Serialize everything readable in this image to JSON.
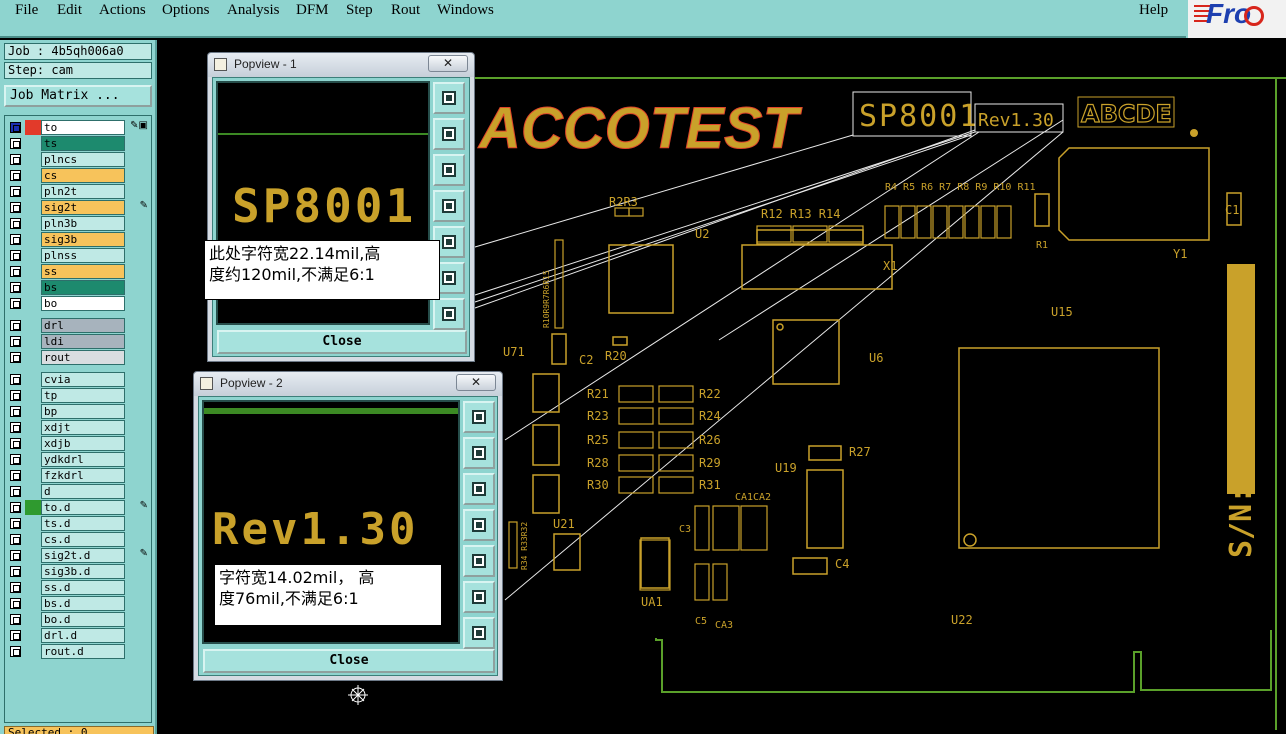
{
  "menu": {
    "items": [
      "File",
      "Edit",
      "Actions",
      "Options",
      "Analysis",
      "DFM",
      "Step",
      "Rout",
      "Windows"
    ],
    "help": "Help"
  },
  "logo": {
    "text": "Fro"
  },
  "job": {
    "label": "Job : 4b5qh006a0",
    "step": "Step: cam",
    "matrix_button": "Job Matrix ..."
  },
  "layers": [
    {
      "name": "to",
      "color": "#ffffff",
      "marker": "#e23a2a",
      "flag": "✎▣"
    },
    {
      "name": "ts",
      "color": "#1d8a6e",
      "marker": "",
      "flag": ""
    },
    {
      "name": "plncs",
      "color": "#bfe9e5",
      "marker": "",
      "flag": ""
    },
    {
      "name": "cs",
      "color": "#f7c35b",
      "marker": "",
      "flag": ""
    },
    {
      "name": "pln2t",
      "color": "#bfe9e5",
      "marker": "",
      "flag": ""
    },
    {
      "name": "sig2t",
      "color": "#f7c35b",
      "marker": "",
      "flag": "✎"
    },
    {
      "name": "pln3b",
      "color": "#bfe9e5",
      "marker": "",
      "flag": ""
    },
    {
      "name": "sig3b",
      "color": "#f7c35b",
      "marker": "",
      "flag": ""
    },
    {
      "name": "plnss",
      "color": "#bfe9e5",
      "marker": "",
      "flag": ""
    },
    {
      "name": "ss",
      "color": "#f7c35b",
      "marker": "",
      "flag": ""
    },
    {
      "name": "bs",
      "color": "#1d8a6e",
      "marker": "",
      "flag": ""
    },
    {
      "name": "bo",
      "color": "#ffffff",
      "marker": "",
      "flag": ""
    },
    {
      "name": "drl",
      "color": "#a7b3bd",
      "marker": "",
      "flag": ""
    },
    {
      "name": "ldi",
      "color": "#a7b3bd",
      "marker": "",
      "flag": ""
    },
    {
      "name": "rout",
      "color": "#d9dde0",
      "marker": "",
      "flag": ""
    },
    {
      "name": "cvia",
      "color": "#bfe9e5",
      "marker": "",
      "flag": ""
    },
    {
      "name": "tp",
      "color": "#bfe9e5",
      "marker": "",
      "flag": ""
    },
    {
      "name": "bp",
      "color": "#bfe9e5",
      "marker": "",
      "flag": ""
    },
    {
      "name": "xdjt",
      "color": "#bfe9e5",
      "marker": "",
      "flag": ""
    },
    {
      "name": "xdjb",
      "color": "#bfe9e5",
      "marker": "",
      "flag": ""
    },
    {
      "name": "ydkdrl",
      "color": "#bfe9e5",
      "marker": "",
      "flag": ""
    },
    {
      "name": "fzkdrl",
      "color": "#bfe9e5",
      "marker": "",
      "flag": ""
    },
    {
      "name": "d",
      "color": "#bfe9e5",
      "marker": "",
      "flag": ""
    },
    {
      "name": "to.d",
      "color": "#bfe9e5",
      "marker": "#2f9a2f",
      "flag": "✎"
    },
    {
      "name": "ts.d",
      "color": "#bfe9e5",
      "marker": "",
      "flag": ""
    },
    {
      "name": "cs.d",
      "color": "#bfe9e5",
      "marker": "",
      "flag": ""
    },
    {
      "name": "sig2t.d",
      "color": "#bfe9e5",
      "marker": "",
      "flag": "✎"
    },
    {
      "name": "sig3b.d",
      "color": "#bfe9e5",
      "marker": "",
      "flag": ""
    },
    {
      "name": "ss.d",
      "color": "#bfe9e5",
      "marker": "",
      "flag": ""
    },
    {
      "name": "bs.d",
      "color": "#bfe9e5",
      "marker": "",
      "flag": ""
    },
    {
      "name": "bo.d",
      "color": "#bfe9e5",
      "marker": "",
      "flag": ""
    },
    {
      "name": "drl.d",
      "color": "#bfe9e5",
      "marker": "",
      "flag": ""
    },
    {
      "name": "rout.d",
      "color": "#bfe9e5",
      "marker": "",
      "flag": ""
    }
  ],
  "selected": "Selected : 0",
  "pcb": {
    "brand": "ACCOTEST",
    "model": "SP8001",
    "rev": "Rev1.30",
    "code": "ABCDE",
    "sn": "S/N:",
    "labels": [
      "R2R3",
      "U2",
      "R12 R13 R14",
      "R4 R5 R6 R7 R8 R9 R10 R11",
      "C1",
      "R1",
      "Y1",
      "X1",
      "U15",
      "U71",
      "C2",
      "R20",
      "U6",
      "R21",
      "R22",
      "R23",
      "R24",
      "R25",
      "R26",
      "R28",
      "R29",
      "R30",
      "R31",
      "R27",
      "U19",
      "CA1",
      "CA2",
      "C3",
      "U21",
      "C4",
      "UA1",
      "C5",
      "CA3",
      "U22",
      "R10R9R7R6R15",
      "R34 R33R32"
    ]
  },
  "popview1": {
    "title": "Popview - 1",
    "close_x": "✕",
    "big": "SP8001",
    "note_line1": "此处字符宽22.14mil,高",
    "note_line2": "度约120mil,不满足6:1",
    "close": "Close"
  },
  "popview2": {
    "title": "Popview - 2",
    "close_x": "✕",
    "big": "Rev1.30",
    "note_line1": "字符宽14.02mil， 高",
    "note_line2": "度76mil,不满足6:1",
    "close": "Close"
  },
  "colors": {
    "panel": "#8ed4cf",
    "silk": "#c9a12a",
    "outline": "#5aa02a"
  }
}
